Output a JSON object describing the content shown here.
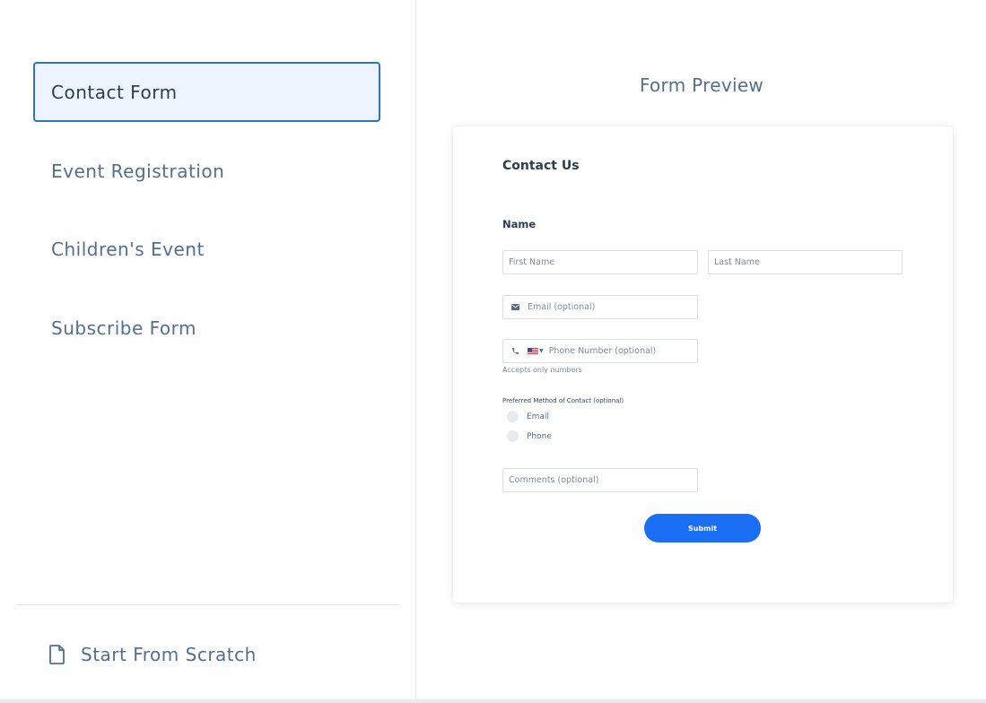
{
  "templates": [
    {
      "label": "Contact Form",
      "active": true
    },
    {
      "label": "Event Registration",
      "active": false
    },
    {
      "label": "Children's Event",
      "active": false
    },
    {
      "label": "Subscribe Form",
      "active": false
    }
  ],
  "start_from_scratch": {
    "label": "Start From Scratch",
    "icon": "document-icon"
  },
  "preview": {
    "title": "Form Preview",
    "form": {
      "heading": "Contact Us",
      "name_label": "Name",
      "first_name_placeholder": "First Name",
      "last_name_placeholder": "Last Name",
      "email_placeholder": "Email  (optional)",
      "email_icon": "envelope-icon",
      "phone_placeholder": "Phone Number  (optional)",
      "phone_icon": "phone-icon",
      "phone_country": "us-flag-icon",
      "phone_helper": "Accepts only numbers",
      "preferred_label": "Preferred Method of Contact  (optional)",
      "preferred_options": [
        "Email",
        "Phone"
      ],
      "comments_placeholder": "Comments  (optional)",
      "submit_label": "Submit"
    }
  },
  "colors": {
    "accent": "#1a6ff5",
    "active_border": "#2a73c9",
    "active_bg": "#eef4fd"
  }
}
